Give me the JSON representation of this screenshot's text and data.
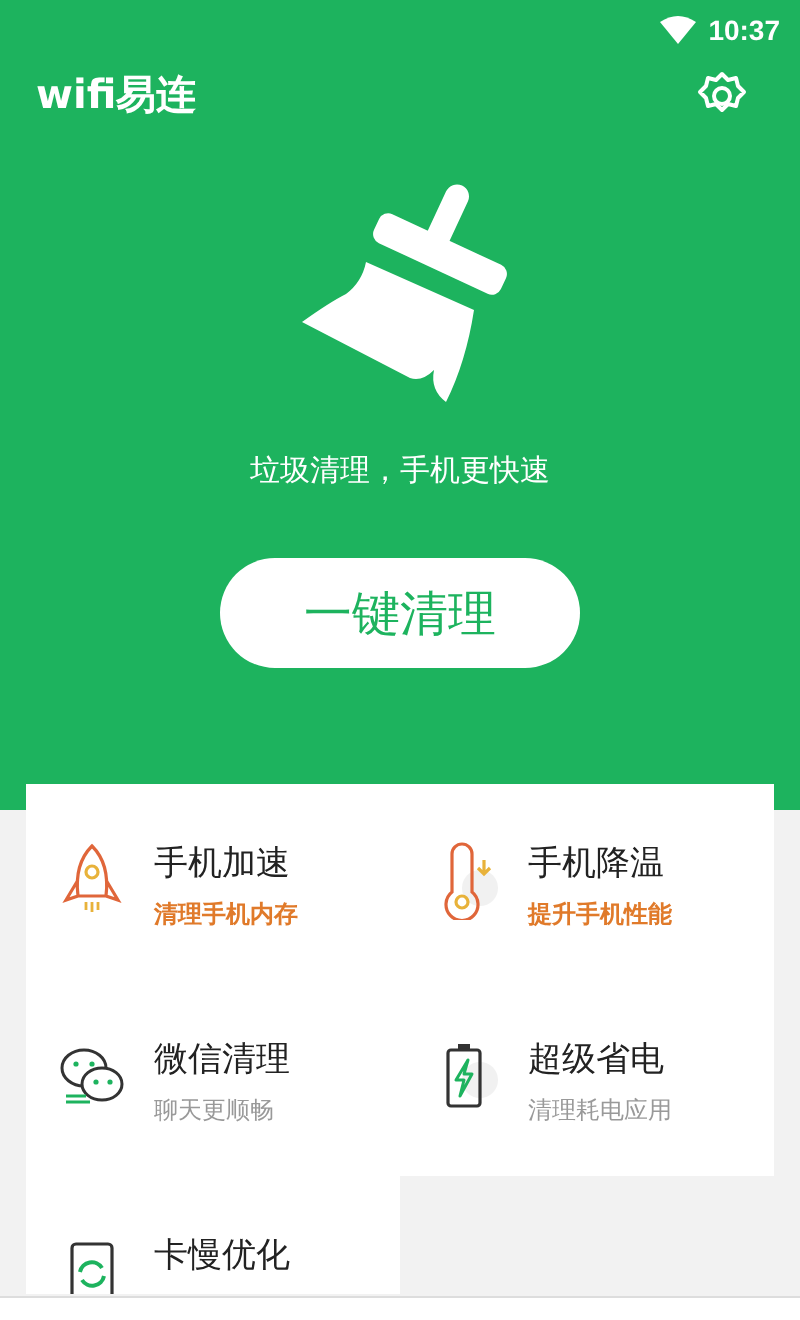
{
  "status_bar": {
    "time": "10:37"
  },
  "app_bar": {
    "title": "wifi易连"
  },
  "hero": {
    "tagline": "垃圾清理，手机更快速",
    "button": "一键清理"
  },
  "features": [
    {
      "kind": "rocket",
      "title": "手机加速",
      "subtitle": "清理手机内存",
      "highlight": true
    },
    {
      "kind": "thermometer",
      "title": "手机降温",
      "subtitle": "提升手机性能",
      "highlight": true
    },
    {
      "kind": "chat",
      "title": "微信清理",
      "subtitle": "聊天更顺畅",
      "highlight": false
    },
    {
      "kind": "battery",
      "title": "超级省电",
      "subtitle": "清理耗电应用",
      "highlight": false
    },
    {
      "kind": "phone-refresh",
      "title": "卡慢优化"
    }
  ]
}
